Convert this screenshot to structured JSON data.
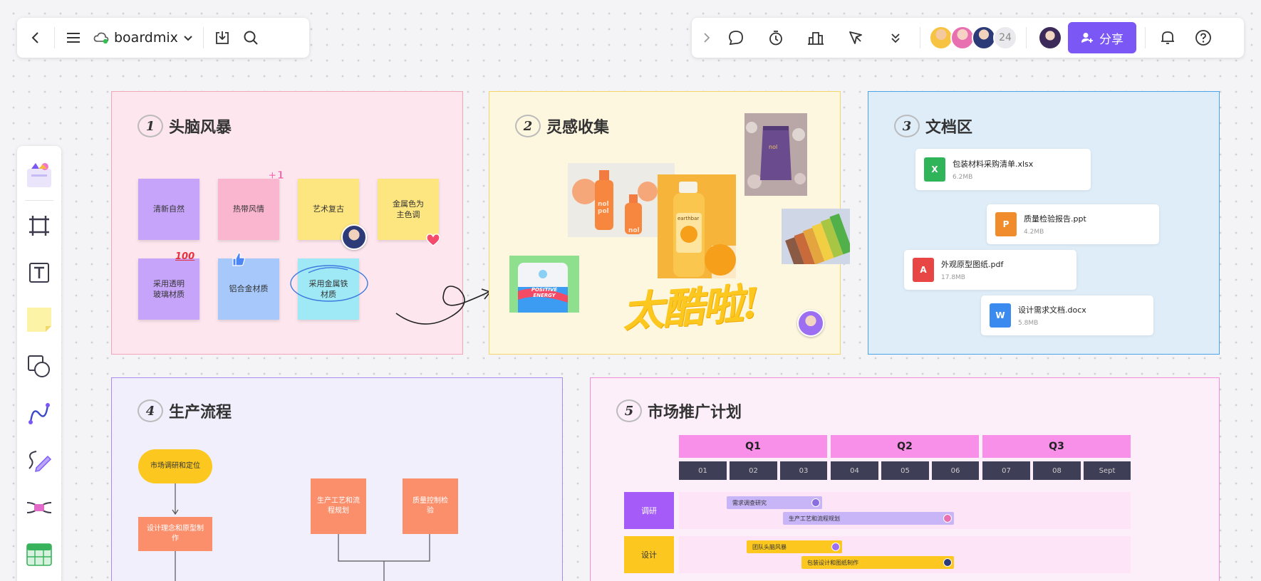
{
  "topbar_left": {
    "brand_name": "boardmix"
  },
  "topbar_right": {
    "collaborator_count": "24",
    "share_label": "分享"
  },
  "left_toolbar": {
    "tools": [
      "template-icon",
      "frame-icon",
      "text-icon",
      "sticky-note-icon",
      "shape-icon",
      "connector-icon",
      "pen-icon",
      "mindmap-icon",
      "table-icon"
    ]
  },
  "frames": {
    "brainstorm": {
      "number": "1",
      "title": "头脑风暴",
      "stickies": [
        "清新自然",
        "热带风情",
        "艺术复古",
        "金属色为\n主色调",
        "采用透明\n玻璃材质",
        "铝合金材质",
        "采用金属铁\n材质"
      ],
      "plus_one": "+1",
      "hundred": "100"
    },
    "inspiration": {
      "number": "2",
      "title": "灵感收集",
      "handwriting": "太酷啦!",
      "image_texts": [
        "nol pol",
        "nol",
        "earthbar",
        "POSITIVE ENERGY"
      ]
    },
    "docs": {
      "number": "3",
      "title": "文档区",
      "files": [
        {
          "name": "包装材料采购清单.xlsx",
          "size": "6.2MB",
          "type": "X",
          "color": "#2fb45a"
        },
        {
          "name": "质量检验报告.ppt",
          "size": "4.2MB",
          "type": "P",
          "color": "#f08c2b"
        },
        {
          "name": "外观原型图纸.pdf",
          "size": "17.8MB",
          "type": "A",
          "color": "#e84545"
        },
        {
          "name": "设计需求文档.docx",
          "size": "5.8MB",
          "type": "W",
          "color": "#3a8af0"
        }
      ]
    },
    "production": {
      "number": "4",
      "title": "生产流程",
      "nodes": [
        "市场调研和定位",
        "设计理念和原型制作",
        "生产工艺和流程规划",
        "质量控制检验"
      ]
    },
    "marketing": {
      "number": "5",
      "title": "市场推广计划",
      "quarters": [
        "Q1",
        "Q2",
        "Q3"
      ],
      "months": [
        "01",
        "02",
        "03",
        "04",
        "05",
        "06",
        "07",
        "08",
        "Sept"
      ],
      "rows": [
        {
          "label": "调研",
          "tasks": [
            "需求调查研究",
            "生产工艺和流程规划"
          ]
        },
        {
          "label": "设计",
          "tasks": [
            "团队头脑风暴",
            "包装设计和图纸制作"
          ]
        }
      ]
    }
  }
}
